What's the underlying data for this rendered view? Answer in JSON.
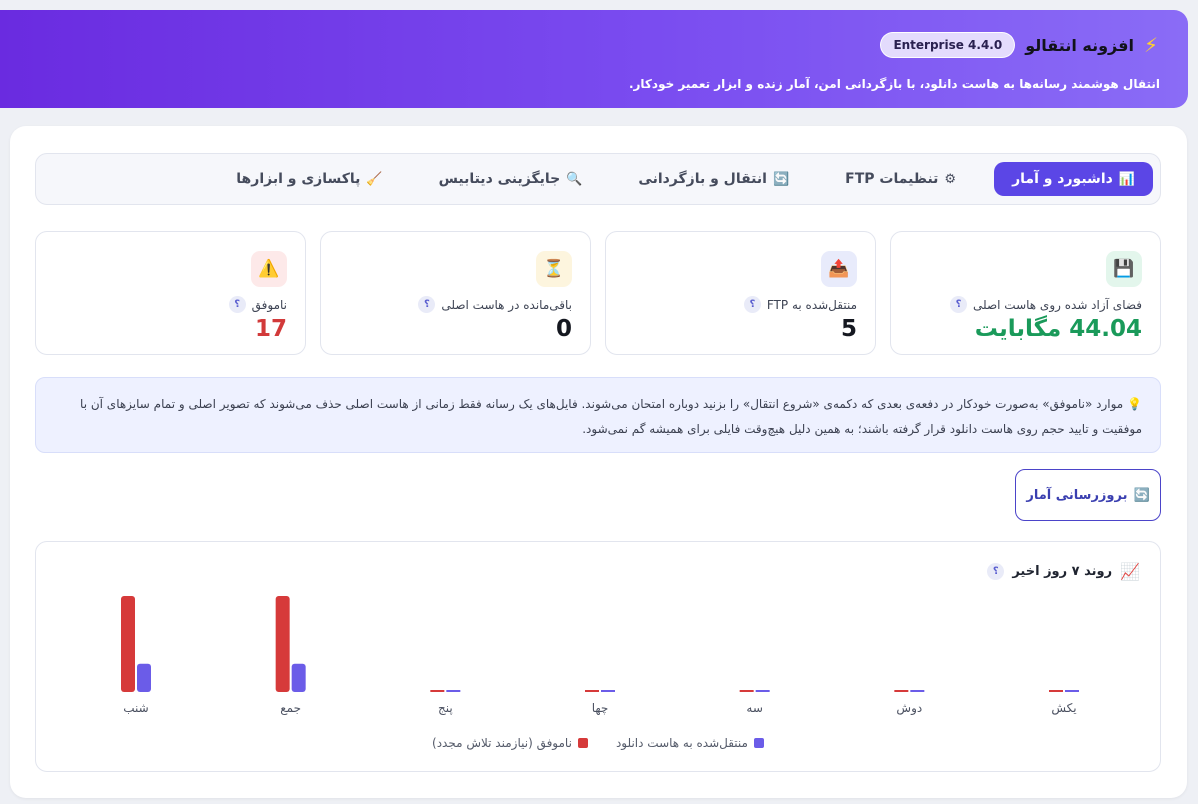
{
  "header": {
    "title": "افزونه انتقالو",
    "version": "Enterprise 4.4.0",
    "subtitle": "انتقال هوشمند رسانه‌ها به هاست دانلود، با بازگردانی امن، آمار زنده و ابزار تعمیر خودکار."
  },
  "tabs": [
    {
      "label": "داشبورد و آمار",
      "icon": "📊",
      "active": true
    },
    {
      "label": "تنظیمات FTP",
      "icon": "⚙",
      "active": false
    },
    {
      "label": "انتقال و بازگردانی",
      "icon": "🔄",
      "active": false
    },
    {
      "label": "جایگزینی دیتابیس",
      "icon": "🔍",
      "active": false
    },
    {
      "label": "پاکسازی و ابزارها",
      "icon": "🧹",
      "active": false
    }
  ],
  "cards": [
    {
      "label": "فضای آزاد شده روی هاست اصلی",
      "value": "44.04 مگابایت",
      "icon": "💾",
      "icon_bg": "#e3f6ec",
      "tone": "green"
    },
    {
      "label": "منتقل‌شده به FTP",
      "value": "5",
      "icon": "📤",
      "icon_bg": "#e8ebfb",
      "tone": "dark"
    },
    {
      "label": "باقی‌مانده در هاست اصلی",
      "value": "0",
      "icon": "⏳",
      "icon_bg": "#fdf5de",
      "tone": "dark"
    },
    {
      "label": "ناموفق",
      "value": "17",
      "icon": "⚠️",
      "icon_bg": "#fde9e9",
      "tone": "red"
    }
  ],
  "help_mark": "؟",
  "notice": {
    "icon": "💡",
    "text": "موارد «ناموفق» به‌صورت خودکار در دفعه‌ی بعدی که دکمه‌ی «شروع انتقال» را بزنید دوباره امتحان می‌شوند. فایل‌های یک رسانه فقط زمانی از هاست اصلی حذف می‌شوند که تصویر اصلی و تمام سایزهای آن با موفقیت و تایید حجم روی هاست دانلود قرار گرفته باشند؛ به همین دلیل هیچ‌وقت فایلی برای همیشه گم نمی‌شود."
  },
  "refresh_button": {
    "label": "بروزرسانی آمار",
    "icon": "🔄"
  },
  "chart_section": {
    "title": "روند ۷ روز اخیر",
    "icon": "📈"
  },
  "colors": {
    "accent": "#5b46e6",
    "failed": "#d63a3a",
    "transferred": "#6b5ce8"
  },
  "chart_data": {
    "type": "bar",
    "categories": [
      "یکش",
      "دوش",
      "سه",
      "چها",
      "پنج",
      "جمع",
      "شنب"
    ],
    "series": [
      {
        "name": "منتقل‌شده به هاست دانلود",
        "color": "#6b5ce8",
        "values": [
          0,
          0,
          0,
          0,
          0,
          5,
          5
        ]
      },
      {
        "name": "ناموفق (نیازمند تلاش مجدد)",
        "color": "#d63a3a",
        "values": [
          0,
          0,
          0,
          0,
          0,
          17,
          17
        ]
      }
    ],
    "ylim": [
      0,
      17
    ],
    "legend": "bottom",
    "grid": false
  }
}
